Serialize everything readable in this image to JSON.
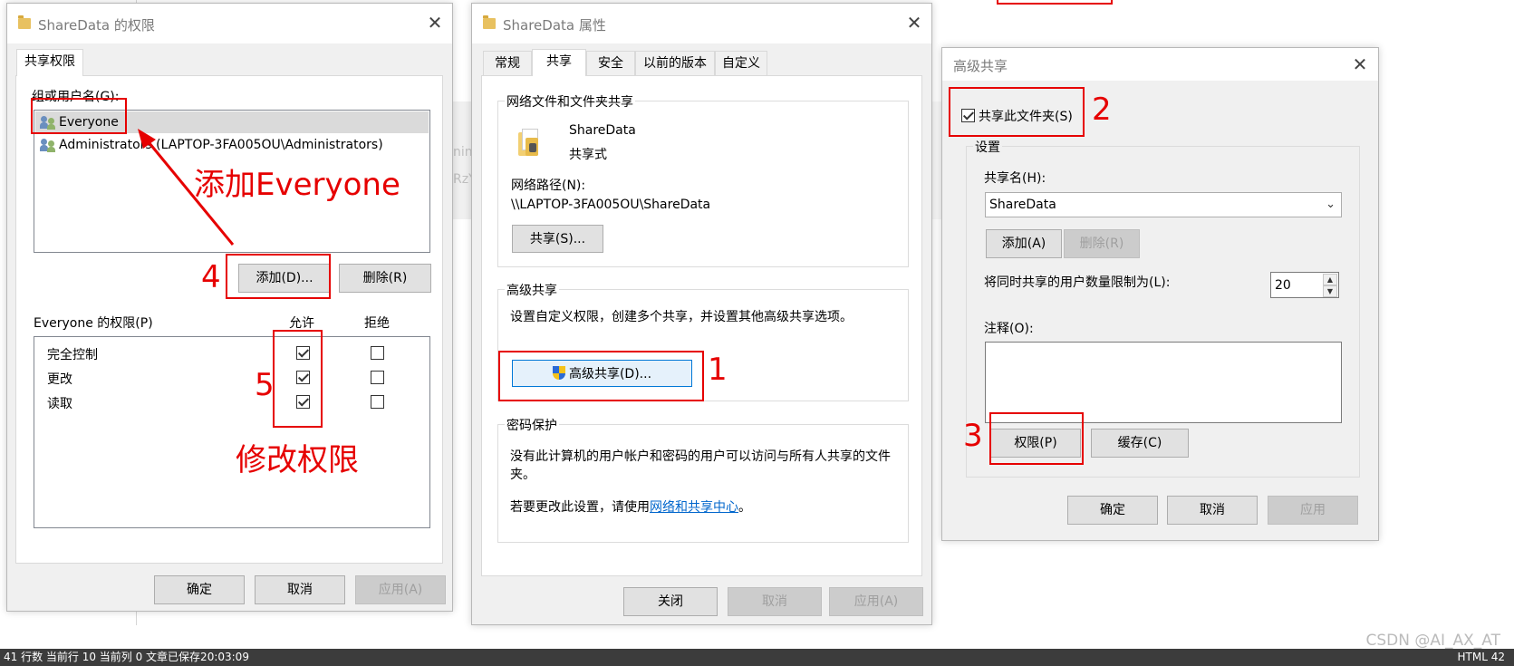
{
  "background": {
    "top_text": "若要更改此设置，请使用网络和共享中心。",
    "status_bar": "41 行数  当前行 10  当前列 0  文章已保存20:03:09",
    "status_right": "HTML  42",
    "watermark": "CSDN @AI_AX_AT",
    "partial_text_1": "nin",
    "partial_text_2": "RzY"
  },
  "perm_window": {
    "title": "ShareData 的权限",
    "tab": "共享权限",
    "group_label": "组或用户名(G):",
    "users": [
      {
        "name": "Everyone"
      },
      {
        "name": "Administrators (LAPTOP-3FA005OU\\Administrators)"
      }
    ],
    "add_button": "添加(D)...",
    "remove_button": "删除(R)",
    "perm_label": "Everyone 的权限(P)",
    "col_allow": "允许",
    "col_deny": "拒绝",
    "perms": [
      {
        "name": "完全控制",
        "allow": true,
        "deny": false
      },
      {
        "name": "更改",
        "allow": true,
        "deny": false
      },
      {
        "name": "读取",
        "allow": true,
        "deny": false
      }
    ],
    "ok": "确定",
    "cancel": "取消",
    "apply": "应用(A)"
  },
  "props_window": {
    "title": "ShareData 属性",
    "tabs": [
      "常规",
      "共享",
      "安全",
      "以前的版本",
      "自定义"
    ],
    "net_group": "网络文件和文件夹共享",
    "folder_name": "ShareData",
    "folder_state": "共享式",
    "net_path_label": "网络路径(N):",
    "net_path": "\\\\LAPTOP-3FA005OU\\ShareData",
    "share_button": "共享(S)...",
    "adv_group": "高级共享",
    "adv_desc": "设置自定义权限，创建多个共享，并设置其他高级共享选项。",
    "adv_button": "高级共享(D)...",
    "pwd_group": "密码保护",
    "pwd_desc_1": "没有此计算机的用户帐户和密码的用户可以访问与所有人共享的文件",
    "pwd_desc_2": "夹。",
    "pwd_change_prefix": "若要更改此设置，请使用",
    "pwd_change_link": "网络和共享中心",
    "pwd_change_suffix": "。",
    "close": "关闭",
    "cancel": "取消",
    "apply": "应用(A)"
  },
  "adv_window": {
    "title": "高级共享",
    "share_checkbox": "共享此文件夹(S)",
    "share_checked": true,
    "settings_group": "设置",
    "share_name_label": "共享名(H):",
    "share_name": "ShareData",
    "add_button": "添加(A)",
    "remove_button": "删除(R)",
    "limit_label": "将同时共享的用户数量限制为(L):",
    "limit_value": "20",
    "comment_label": "注释(O):",
    "perm_button": "权限(P)",
    "cache_button": "缓存(C)",
    "ok": "确定",
    "cancel": "取消",
    "apply": "应用"
  },
  "annotations": {
    "step1": "1",
    "step2": "2",
    "step3": "3",
    "step4": "4",
    "step5": "5",
    "add_everyone": "添加Everyone",
    "modify_perms": "修改权限"
  },
  "colors": {
    "annotation_red": "#e60000",
    "link_blue": "#0066cc",
    "window_bg": "#f0f0f0"
  }
}
